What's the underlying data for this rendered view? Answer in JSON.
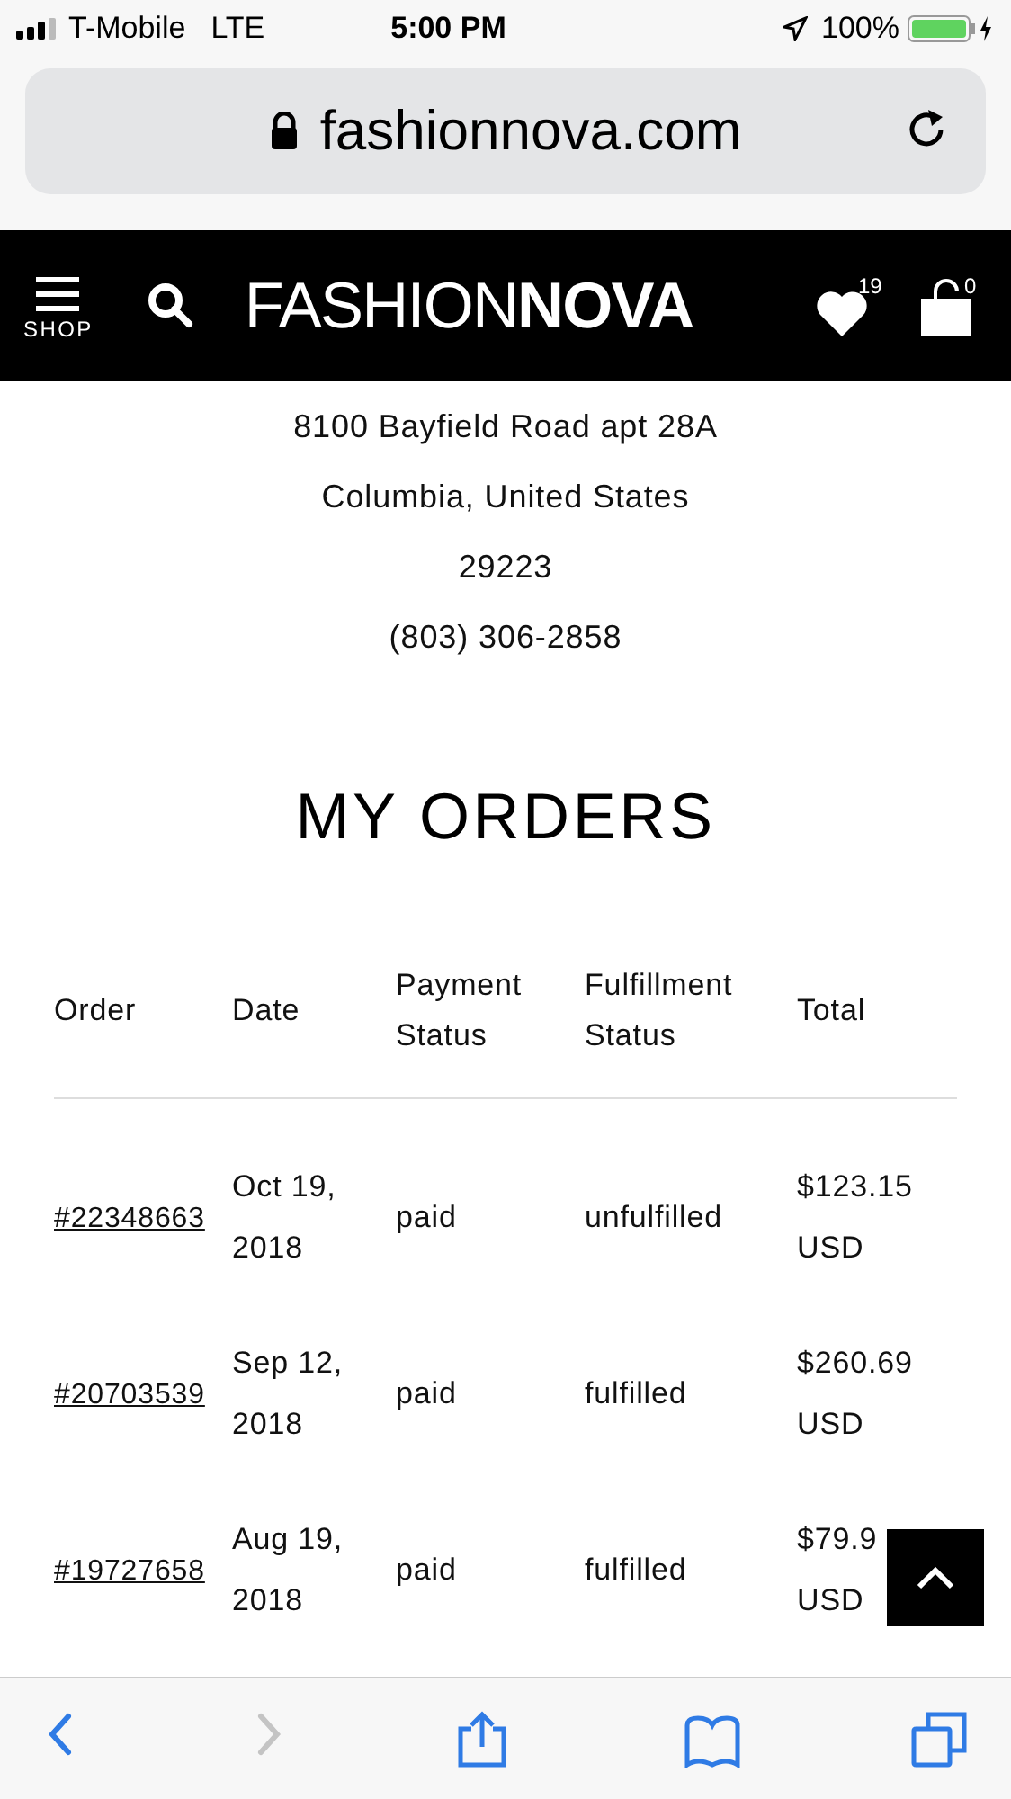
{
  "status_bar": {
    "carrier": "T-Mobile",
    "network": "LTE",
    "time": "5:00 PM",
    "battery": "100%"
  },
  "address_bar": {
    "url": "fashionnova.com"
  },
  "header": {
    "menu_label": "SHOP",
    "logo": {
      "light": "FASHION",
      "bold": "NOVA"
    },
    "wishlist_count": "19",
    "cart_count": "0"
  },
  "address": [
    "8100 Bayfield Road apt 28A",
    "Columbia, United States",
    "29223",
    "(803) 306-2858"
  ],
  "title": "MY ORDERS",
  "table": {
    "columns": [
      [
        "Order"
      ],
      [
        "Date"
      ],
      [
        "Payment",
        "Status"
      ],
      [
        "Fulfillment",
        "Status"
      ],
      [
        "Total"
      ]
    ],
    "rows": [
      {
        "order": "#22348663",
        "date": [
          "Oct 19,",
          "2018"
        ],
        "payment": "paid",
        "fulfillment": "unfulfilled",
        "total": [
          "$123.15",
          "USD"
        ]
      },
      {
        "order": "#20703539",
        "date": [
          "Sep 12,",
          "2018"
        ],
        "payment": "paid",
        "fulfillment": "fulfilled",
        "total": [
          "$260.69",
          "USD"
        ]
      },
      {
        "order": "#19727658",
        "date": [
          "Aug 19,",
          "2018"
        ],
        "payment": "paid",
        "fulfillment": "fulfilled",
        "total": [
          "$79.9",
          "USD"
        ]
      }
    ]
  },
  "toolbar": [
    {
      "kind": "back",
      "disabled": false
    },
    {
      "kind": "forward",
      "disabled": true
    },
    {
      "kind": "share",
      "disabled": false
    },
    {
      "kind": "bookmarks",
      "disabled": false
    },
    {
      "kind": "tabs",
      "disabled": false
    }
  ]
}
